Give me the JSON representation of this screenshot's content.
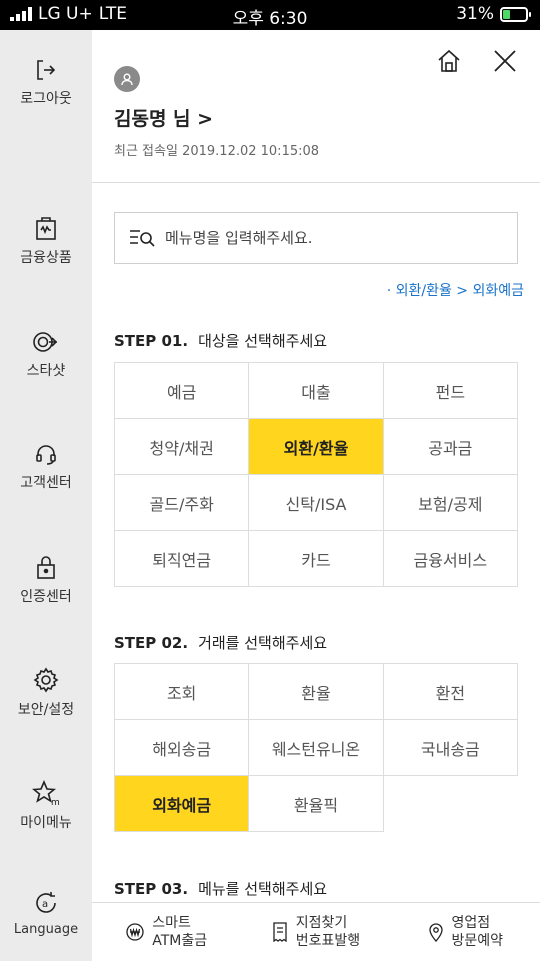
{
  "status_bar": {
    "carrier": "LG U+",
    "network": "LTE",
    "time": "오후 6:30",
    "battery": "31%",
    "battery_level": 0.31
  },
  "sidebar": {
    "items": [
      {
        "label": "로그아웃",
        "icon": "logout-icon"
      },
      {
        "label": "금융상품",
        "icon": "bag-icon"
      },
      {
        "label": "스타샷",
        "icon": "starshot-icon"
      },
      {
        "label": "고객센터",
        "icon": "headset-icon"
      },
      {
        "label": "인증센터",
        "icon": "lock-icon"
      },
      {
        "label": "보안/설정",
        "icon": "gear-icon"
      },
      {
        "label": "마이메뉴",
        "icon": "star-icon"
      },
      {
        "label": "Language",
        "icon": "language-icon"
      }
    ]
  },
  "header": {
    "user_name": "김동명 님 >",
    "last_login_label": "최근 접속일",
    "last_login_value": "2019.12.02 10:15:08"
  },
  "search": {
    "placeholder": "메뉴명을 입력해주세요."
  },
  "breadcrumb": "· 외환/환율 > 외화예금",
  "step1": {
    "title": "STEP 01.",
    "desc": "대상을 선택해주세요",
    "items": [
      "예금",
      "대출",
      "펀드",
      "청약/채권",
      "외환/환율",
      "공과금",
      "골드/주화",
      "신탁/ISA",
      "보험/공제",
      "퇴직연금",
      "카드",
      "금융서비스"
    ],
    "selected": "외환/환율"
  },
  "step2": {
    "title": "STEP 02.",
    "desc": "거래를 선택해주세요",
    "items": [
      "조회",
      "환율",
      "환전",
      "해외송금",
      "웨스턴유니온",
      "국내송금",
      "외화예금",
      "환율픽"
    ],
    "selected": "외화예금"
  },
  "step3": {
    "title": "STEP 03.",
    "desc": "메뉴를 선택해주세요"
  },
  "bottom_bar": [
    {
      "line1": "스마트",
      "line2": "ATM출금",
      "icon": "atm-won-icon"
    },
    {
      "line1": "지점찾기",
      "line2": "번호표발행",
      "icon": "ticket-icon"
    },
    {
      "line1": "영업점",
      "line2": "방문예약",
      "icon": "location-pin-icon"
    }
  ],
  "colors": {
    "accent": "#ffd51e",
    "link": "#1a73c9",
    "sidebar_bg": "#ebebeb"
  }
}
